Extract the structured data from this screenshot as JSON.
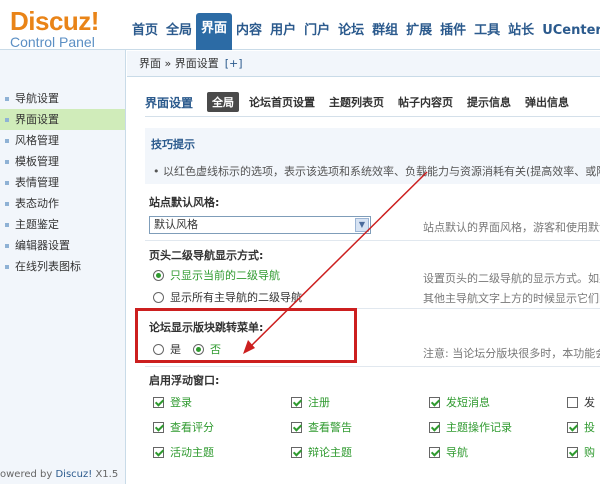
{
  "logo": {
    "brand": "Discuz!",
    "sub": "Control Panel"
  },
  "topnav": [
    "首页",
    "全局",
    "界面",
    "内容",
    "用户",
    "门户",
    "论坛",
    "群组",
    "扩展",
    "插件",
    "工具",
    "站长",
    "UCenter"
  ],
  "topnav_active": "界面",
  "breadcrumb": {
    "text": "界面 » 界面设置",
    "plus": "[+]"
  },
  "sidebar": {
    "items": [
      "导航设置",
      "界面设置",
      "风格管理",
      "模板管理",
      "表情管理",
      "表态动作",
      "主题鉴定",
      "编辑器设置",
      "在线列表图标"
    ],
    "active": "界面设置"
  },
  "poweredby": {
    "prefix": "owered by ",
    "link": "Discuz!",
    "version": " X1.5"
  },
  "main": {
    "title": "界面设置",
    "tabs": [
      "全局",
      "论坛首页设置",
      "主题列表页",
      "帖子内容页",
      "提示信息",
      "弹出信息"
    ],
    "active_tab": "全局",
    "tips_title": "技巧提示",
    "tips_text": "• 以红色虚线标示的选项，表示该选项和系统效率、负载能力与资源消耗有关(提高效率、或降低",
    "default_style_label": "站点默认风格:",
    "default_style_value": "默认风格",
    "default_style_desc": "站点默认的界面风格，游客和使用默认",
    "subnav_label": "页头二级导航显示方式:",
    "subnav_opt1": "只显示当前的二级导航",
    "subnav_opt2": "显示所有主导航的二级导航",
    "subnav_desc1": "设置页头的二级导航的显示方式。如果",
    "subnav_desc2": "其他主导航文字上方的时候显示它们的",
    "jump_label": "论坛显示版块跳转菜单:",
    "jump_yes": "是",
    "jump_no": "否",
    "jump_desc": "注意: 当论坛分版块很多时，本功能会",
    "float_label": "启用浮动窗口:",
    "float_items": [
      [
        "登录",
        "注册",
        "发短消息",
        "发"
      ],
      [
        "查看评分",
        "查看警告",
        "主题操作记录",
        "投"
      ],
      [
        "活动主题",
        "辩论主题",
        "导航",
        "购"
      ]
    ]
  },
  "colors": {
    "accent": "#2c6ba5",
    "highlight": "#cc1f1f",
    "active_sidebar": "#d0ecba"
  }
}
